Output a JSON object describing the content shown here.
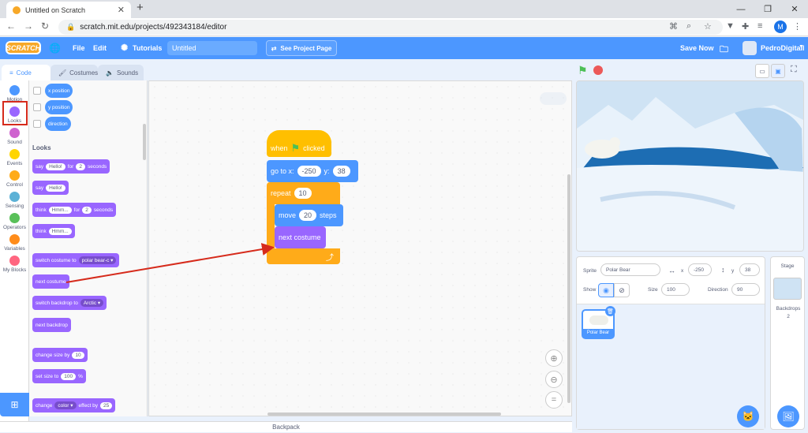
{
  "browser": {
    "tab_title": "Untitled on Scratch",
    "url": "scratch.mit.edu/projects/492343184/editor",
    "account_initial": "M"
  },
  "menubar": {
    "logo": "SCRATCH",
    "file": "File",
    "edit": "Edit",
    "tutorials": "Tutorials",
    "project_title": "Untitled",
    "see_project": "See Project Page",
    "save_now": "Save Now",
    "username": "PedroDigitall"
  },
  "editor_tabs": {
    "code": "Code",
    "costumes": "Costumes",
    "sounds": "Sounds"
  },
  "categories": [
    {
      "label": "Motion",
      "color": "#4c97ff"
    },
    {
      "label": "Looks",
      "color": "#9966ff"
    },
    {
      "label": "Sound",
      "color": "#cf63cf"
    },
    {
      "label": "Events",
      "color": "#ffd500"
    },
    {
      "label": "Control",
      "color": "#ffab19"
    },
    {
      "label": "Sensing",
      "color": "#5cb1d6"
    },
    {
      "label": "Operators",
      "color": "#59c059"
    },
    {
      "label": "Variables",
      "color": "#ff8c1a"
    },
    {
      "label": "My Blocks",
      "color": "#ff6680"
    }
  ],
  "palette": {
    "reporters": [
      "x position",
      "y position",
      "direction"
    ],
    "section_title": "Looks",
    "say_for": {
      "say": "say",
      "msg": "Hello!",
      "for": "for",
      "secs": "2",
      "unit": "seconds"
    },
    "say": {
      "say": "say",
      "msg": "Hello!"
    },
    "think_for": {
      "think": "think",
      "msg": "Hmm...",
      "for": "for",
      "secs": "2",
      "unit": "seconds"
    },
    "think": {
      "think": "think",
      "msg": "Hmm..."
    },
    "switch_costume": {
      "label": "switch costume to",
      "value": "polar bear-c"
    },
    "next_costume": "next costume",
    "switch_backdrop": {
      "label": "switch backdrop to",
      "value": "Arctic"
    },
    "next_backdrop": "next backdrop",
    "change_size": {
      "label": "change size by",
      "value": "10"
    },
    "set_size": {
      "label": "set size to",
      "value": "100",
      "unit": "%"
    },
    "change_effect": {
      "label": "change",
      "effect": "color",
      "by": "effect by",
      "value": "25"
    }
  },
  "script": {
    "when_flag": {
      "when": "when",
      "clicked": "clicked"
    },
    "goto": {
      "label": "go to x:",
      "x": "-250",
      "ylabel": "y:",
      "y": "38"
    },
    "repeat": {
      "label": "repeat",
      "value": "10"
    },
    "move": {
      "label": "move",
      "value": "20",
      "unit": "steps"
    },
    "next_costume": "next costume"
  },
  "backpack": "Backpack",
  "sprite_info": {
    "sprite_label": "Sprite",
    "sprite_name": "Polar Bear",
    "x_label": "x",
    "x": "-250",
    "y_label": "y",
    "y": "38",
    "show_label": "Show",
    "size_label": "Size",
    "size": "100",
    "direction_label": "Direction",
    "direction": "90"
  },
  "sprite_tile": "Polar Bear",
  "stage_pane": {
    "title": "Stage",
    "backdrops_label": "Backdrops",
    "backdrops_count": "2"
  }
}
